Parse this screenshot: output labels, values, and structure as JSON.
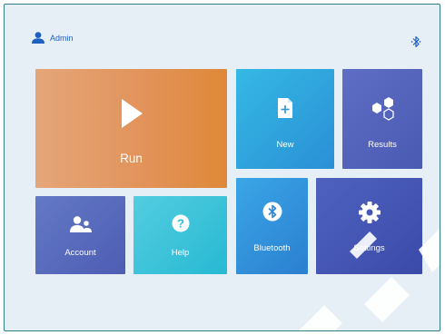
{
  "header": {
    "username": "Admin",
    "user_icon": "user-icon",
    "bluetooth_icon": "bluetooth-icon"
  },
  "tiles": {
    "run": {
      "label": "Run",
      "icon": "play-icon",
      "color": "#e29258"
    },
    "new": {
      "label": "New",
      "icon": "new-file-icon",
      "color": "#2fa3dd"
    },
    "results": {
      "label": "Results",
      "icon": "hexagons-icon",
      "color": "#5564bb"
    },
    "account": {
      "label": "Account",
      "icon": "users-icon",
      "color": "#5a6abc"
    },
    "help": {
      "label": "Help",
      "icon": "help-icon",
      "color": "#3cc3da"
    },
    "bluetooth": {
      "label": "Bluetooth",
      "icon": "bluetooth-icon",
      "color": "#3393db"
    },
    "settings": {
      "label": "Settings",
      "icon": "gear-icon",
      "color": "#4556b4"
    }
  },
  "colors": {
    "accent": "#1f5fbf",
    "frame": "#2f7f86",
    "background": "#e6eff6"
  }
}
